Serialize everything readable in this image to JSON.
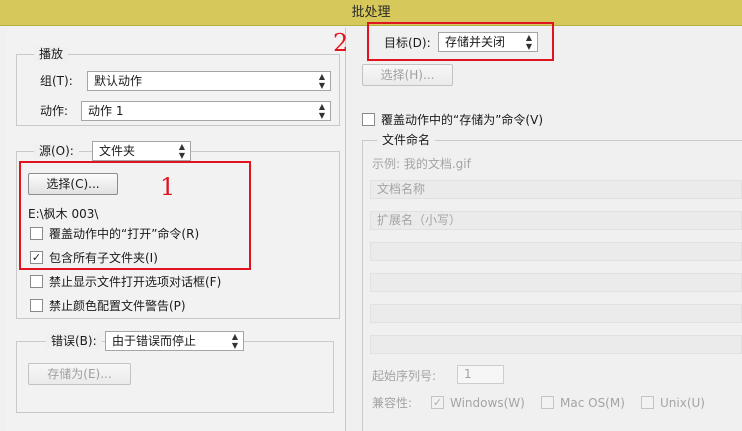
{
  "window": {
    "title": "批处理"
  },
  "play": {
    "legend": "播放",
    "set_label": "组(T):",
    "set_value": "默认动作",
    "action_label": "动作:",
    "action_value": "动作 1"
  },
  "source": {
    "legend_label": "源(O):",
    "legend_value": "文件夹",
    "choose_button": "选择(C)...",
    "path": "E:\\枫木 003\\",
    "override_open": {
      "label": "覆盖动作中的“打开”命令(R)",
      "checked": false
    },
    "include_subfolders": {
      "label": "包含所有子文件夹(I)",
      "checked": true
    },
    "suppress_dialogs": {
      "label": "禁止显示文件打开选项对话框(F)",
      "checked": false
    },
    "suppress_color": {
      "label": "禁止颜色配置文件警告(P)",
      "checked": false
    }
  },
  "errors": {
    "legend_label": "错误(B):",
    "legend_value": "由于错误而停止",
    "save_as_button": "存储为(E)..."
  },
  "destination": {
    "label": "目标(D):",
    "value": "存储并关闭",
    "choose_button": "选择(H)...",
    "override_save": {
      "label": "覆盖动作中的“存储为”命令(V)",
      "checked": false
    }
  },
  "naming": {
    "legend": "文件命名",
    "example": "示例: 我的文档.gif",
    "fields": [
      "文档名称",
      "扩展名（小写）",
      "",
      "",
      "",
      ""
    ],
    "start_serial_label": "起始序列号:",
    "start_serial_value": "1",
    "compat_label": "兼容性:",
    "compat": [
      {
        "label": "Windows(W)",
        "checked": true
      },
      {
        "label": "Mac OS(M)",
        "checked": false
      },
      {
        "label": "Unix(U)",
        "checked": false
      }
    ]
  },
  "annotations": {
    "one": "1",
    "two": "2"
  },
  "icons": {
    "check": "check-icon",
    "arrow": "updown-arrow-icon"
  },
  "colors": {
    "highlight": "#e0141e",
    "titlebar": "#d6c85a"
  }
}
